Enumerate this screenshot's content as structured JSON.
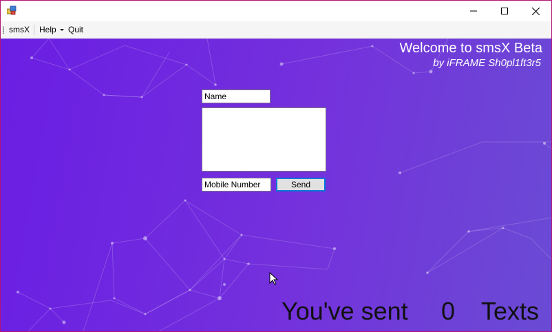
{
  "window": {
    "controls": {
      "minimize": "minimize-icon",
      "maximize": "maximize-icon",
      "close": "close-icon"
    },
    "border_color": "#b4127a"
  },
  "menubar": {
    "items": [
      {
        "label": "smsX"
      },
      {
        "label": "Help"
      },
      {
        "label": "Quit"
      }
    ]
  },
  "header": {
    "title": "Welcome to smsX Beta",
    "byline": "by iFRAME Sh0pl1ft3r5"
  },
  "form": {
    "name_value": "Name",
    "message_value": "",
    "mobile_value": "Mobile Number",
    "send_label": "Send"
  },
  "counter": {
    "prefix": "You've sent",
    "count": "0",
    "suffix": "Texts"
  },
  "colors": {
    "background_start": "#6a1ee3",
    "background_end": "#6a4bd4",
    "accent": "#0078d7"
  }
}
